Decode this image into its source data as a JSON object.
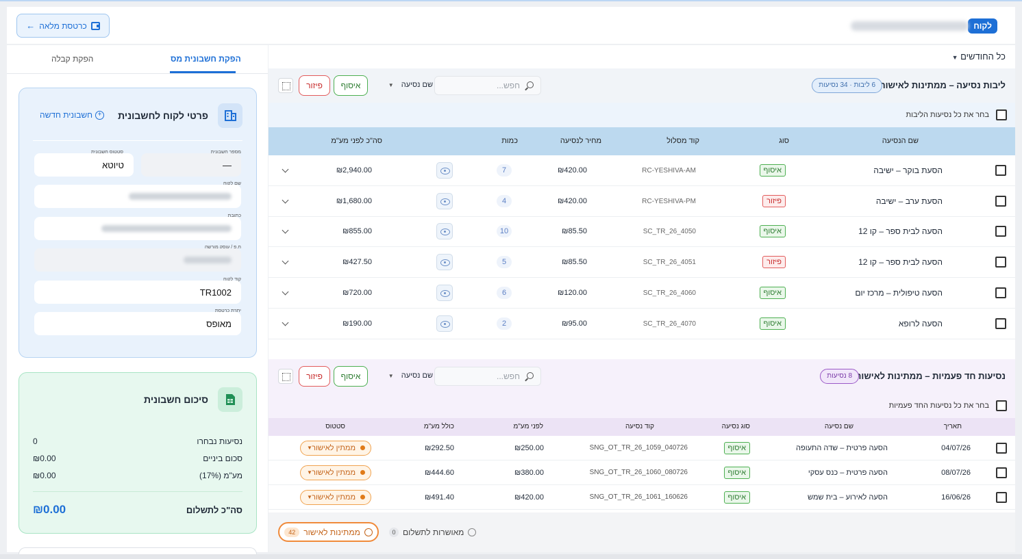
{
  "header": {
    "customer_pill": "לקוח",
    "full_card_button": "כרטסת מלאה"
  },
  "filters": {
    "months": "כל החודשים"
  },
  "escort_section": {
    "title": "ליבות נסיעה – ממתינות לאישור",
    "count": "6 ליבות · 34 נסיעות",
    "search_placeholder": "חפש...",
    "sort_label": "שם נסיעה",
    "pickup_label": "איסוף",
    "dropoff_label": "פיזור",
    "select_all": "בחר את כל נסיעות הליבות",
    "columns": [
      "שם הנסיעה",
      "סוג",
      "קוד מסלול",
      "מחיר לנסיעה",
      "כמות",
      "סה\"כ לפני מע\"מ"
    ],
    "rows": [
      {
        "name": "הסעת בוקר – ישיבה",
        "type": "איסוף",
        "type_kind": "g",
        "code": "RC-YESHIVA-AM",
        "price": "₪420.00",
        "qty": "7",
        "total": "₪2,940.00"
      },
      {
        "name": "הסעת ערב – ישיבה",
        "type": "פיזור",
        "type_kind": "r",
        "code": "RC-YESHIVA-PM",
        "price": "₪420.00",
        "qty": "4",
        "total": "₪1,680.00"
      },
      {
        "name": "הסעה לבית ספר – קו 12",
        "type": "איסוף",
        "type_kind": "g",
        "code": "SC_TR_26_4050",
        "price": "₪85.50",
        "qty": "10",
        "total": "₪855.00"
      },
      {
        "name": "הסעה לבית ספר – קו 12",
        "type": "פיזור",
        "type_kind": "r",
        "code": "SC_TR_26_4051",
        "price": "₪85.50",
        "qty": "5",
        "total": "₪427.50"
      },
      {
        "name": "הסעה טיפולית – מרכז יום",
        "type": "איסוף",
        "type_kind": "g",
        "code": "SC_TR_26_4060",
        "price": "₪120.00",
        "qty": "6",
        "total": "₪720.00"
      },
      {
        "name": "הסעה לרופא",
        "type": "איסוף",
        "type_kind": "g",
        "code": "SC_TR_26_4070",
        "price": "₪95.00",
        "qty": "2",
        "total": "₪190.00"
      }
    ]
  },
  "oneoff_section": {
    "title": "נסיעות חד פעמיות – ממתינות לאישור",
    "count": "8 נסיעות",
    "search_placeholder": "חפש...",
    "sort_label": "שם נסיעה",
    "pickup_label": "איסוף",
    "dropoff_label": "פיזור",
    "select_all": "בחר את כל נסיעות החד פעמיות",
    "columns": [
      "תאריך",
      "שם נסיעה",
      "סוג נסיעה",
      "קוד נסיעה",
      "לפני מע\"מ",
      "כולל מע\"מ",
      "סטטוס"
    ],
    "rows": [
      {
        "date": "04/07/26",
        "name": "הסעה פרטית – שדה התעופה",
        "type": "איסוף",
        "code": "SNG_OT_TR_26_1059_040726",
        "pre": "₪250.00",
        "incl": "₪292.50",
        "status": "ממתין לאישור"
      },
      {
        "date": "08/07/26",
        "name": "הסעה פרטית – כנס עסקי",
        "type": "איסוף",
        "code": "SNG_OT_TR_26_1060_080726",
        "pre": "₪380.00",
        "incl": "₪444.60",
        "status": "ממתין לאישור"
      },
      {
        "date": "16/06/26",
        "name": "הסעה לאירוע – בית שמש",
        "type": "איסוף",
        "code": "SNG_OT_TR_26_1061_160626",
        "pre": "₪420.00",
        "incl": "₪491.40",
        "status": "ממתין לאישור"
      }
    ]
  },
  "footer": {
    "approved_label": "מאושרות לתשלום",
    "approved_count": "0",
    "pending_label": "ממתינות לאישור",
    "pending_count": "42"
  },
  "sidebar": {
    "tab_invoice": "הפקת חשבונית מס",
    "tab_receipt": "הפקת קבלה",
    "customer_card": {
      "title": "פרטי לקוח לחשבונית",
      "new_invoice": "חשבונית חדשה",
      "invoice_number_label": "מספר חשבונית",
      "invoice_number_value": "—",
      "invoice_status_label": "סטטוס חשבונית",
      "invoice_status_value": "טיוטא",
      "customer_name_label": "שם לקוח",
      "address_label": "כתובת",
      "id_label": "ח.פ / עוסק מורשה",
      "customer_code_label": "קוד לקוח",
      "customer_code_value": "TR1002",
      "balance_label": "יתרת כרטסת",
      "balance_value": "מאופס"
    },
    "summary_card": {
      "title": "סיכום חשבונית",
      "selected_label": "נסיעות נבחרו",
      "selected_value": "0",
      "subtotal_label": "סכום ביניים",
      "subtotal_value": "₪0.00",
      "vat_label": "מע\"מ (17%)",
      "vat_value": "₪0.00",
      "total_label": "סה\"כ לתשלום",
      "total_value": "₪0.00"
    }
  }
}
